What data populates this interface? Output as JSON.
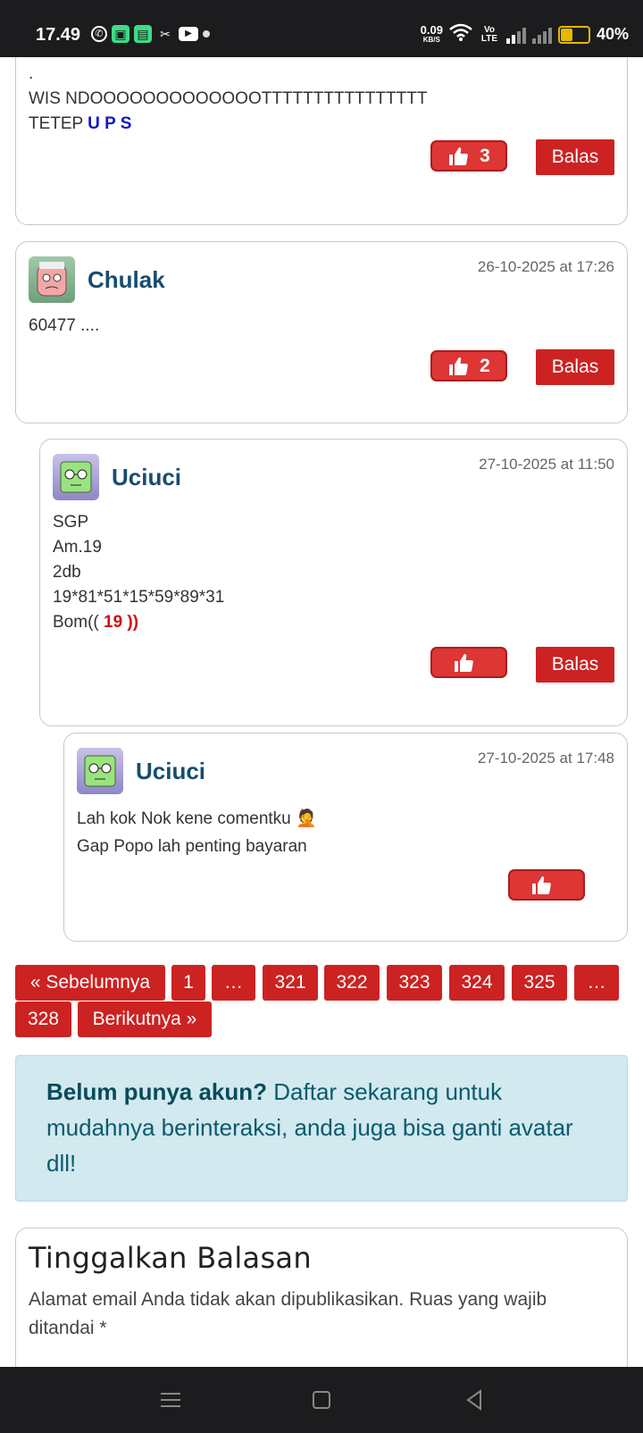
{
  "status_bar": {
    "time": "17.49",
    "net_speed": "0.09",
    "net_unit": "KB/S",
    "volte": "Vo LTE",
    "battery": "40%",
    "icons": [
      "whatsapp-icon",
      "app-icon",
      "messages-icon",
      "scissors-icon",
      "youtube-icon",
      "dot-icon",
      "wifi-icon",
      "signal-icon",
      "battery-icon"
    ]
  },
  "comments": [
    {
      "id": "c0",
      "body_lines": [
        ".",
        "WIS NDOOOOOOOOOOOOOTTTTTTTTTTTTTTTT"
      ],
      "last_prefix": "TETEP ",
      "last_emph": "U P S",
      "likes": "3",
      "reply_label": "Balas"
    },
    {
      "id": "c1",
      "author": "Chulak",
      "date": "26-10-2025 at 17:26",
      "body_lines": [
        "60477 ...."
      ],
      "likes": "2",
      "reply_label": "Balas"
    },
    {
      "id": "c2",
      "author": "Uciuci",
      "date": "27-10-2025 at 11:50",
      "body_lines": [
        "SGP",
        "Am.19",
        "2db",
        "19*81*51*15*59*89*31"
      ],
      "last_prefix": "Bom(( ",
      "last_emph": "19 ))",
      "likes": "",
      "reply_label": "Balas"
    },
    {
      "id": "c3",
      "author": "Uciuci",
      "date": "27-10-2025 at 17:48",
      "body_lines": [
        "Lah kok Nok kene comentku 🤦",
        "Gap Popo lah penting bayaran"
      ],
      "likes": ""
    }
  ],
  "pagination": {
    "prev": "« Sebelumnya",
    "pages": [
      "1",
      "…",
      "321",
      "322",
      "323",
      "324",
      "325",
      "…",
      "328"
    ],
    "next": "Berikutnya »"
  },
  "notice": {
    "bold": "Belum punya akun?",
    "text": " Daftar sekarang untuk mudahnya berinteraksi, anda juga bisa ganti avatar dll!"
  },
  "reply_form": {
    "title": "Tinggalkan Balasan",
    "note": "Alamat email Anda tidak akan dipublikasikan. Ruas yang wajib ditandai *"
  },
  "colors": {
    "accent": "#cc2222",
    "author": "#164d6e",
    "emph_blue": "#1515c8",
    "emph_red": "#d01010",
    "notice_bg": "#d1e9ef"
  }
}
